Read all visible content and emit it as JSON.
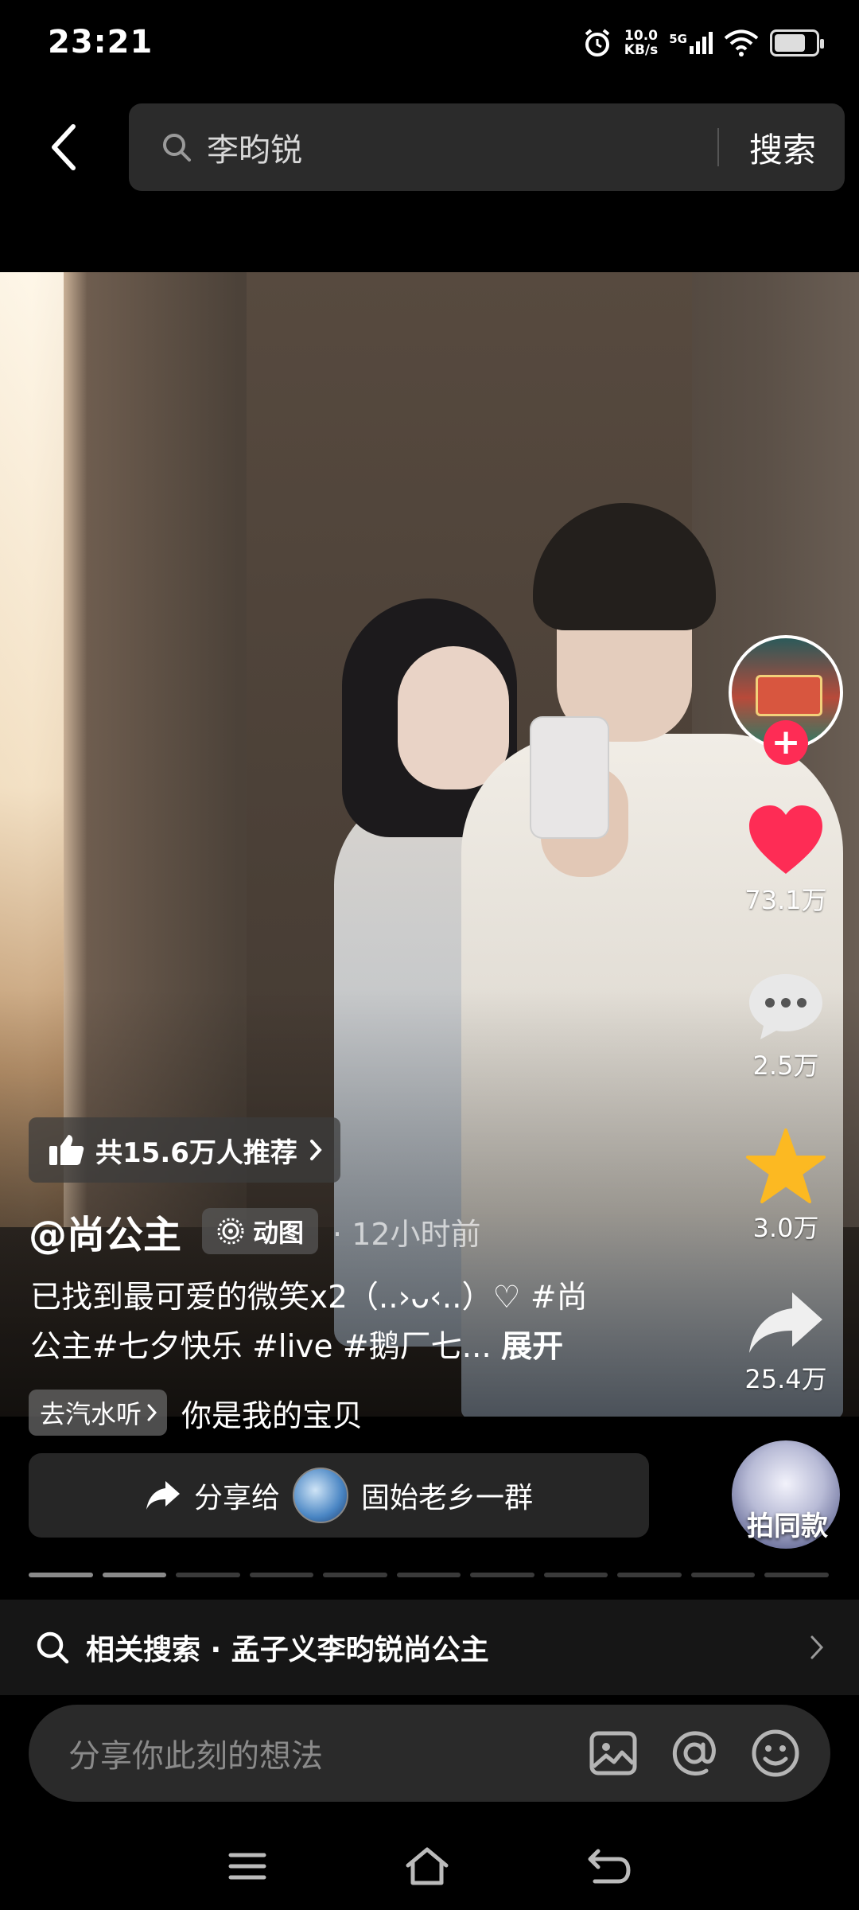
{
  "status_bar": {
    "time": "23:21",
    "speed_value": "10.0",
    "speed_unit": "KB/s",
    "network": "5G",
    "battery_level": 0.75
  },
  "header": {
    "search_query": "李昀锐",
    "search_button": "搜索"
  },
  "video": {
    "recommend_text": "共15.6万人推荐",
    "author": "@尚公主",
    "type_badge": "动图",
    "time_ago": "· 12小时前",
    "caption_line1": "已找到最可爱的微笑x2（..›ᴗ‹..）♡ #尚",
    "caption_line2": "公主#七夕快乐 #live #鹅厂七...",
    "expand_label": "展开",
    "music_tag": "去汽水听",
    "music_title": "你是我的宝贝"
  },
  "rail": {
    "likes": "73.1万",
    "comments": "2.5万",
    "favorites": "3.0万",
    "shares": "25.4万",
    "follow_plus": "+"
  },
  "share_bar": {
    "share_to": "分享给",
    "group_name": "固始老乡一群",
    "same_style": "拍同款"
  },
  "progress": {
    "segments": 11,
    "completed": 2
  },
  "related_search": {
    "label": "相关搜索 · 孟子义李昀锐尚公主"
  },
  "comment_input": {
    "placeholder": "分享你此刻的想法"
  },
  "colors": {
    "accent": "#fe2c55",
    "star": "#fcb922",
    "background": "#000000"
  }
}
